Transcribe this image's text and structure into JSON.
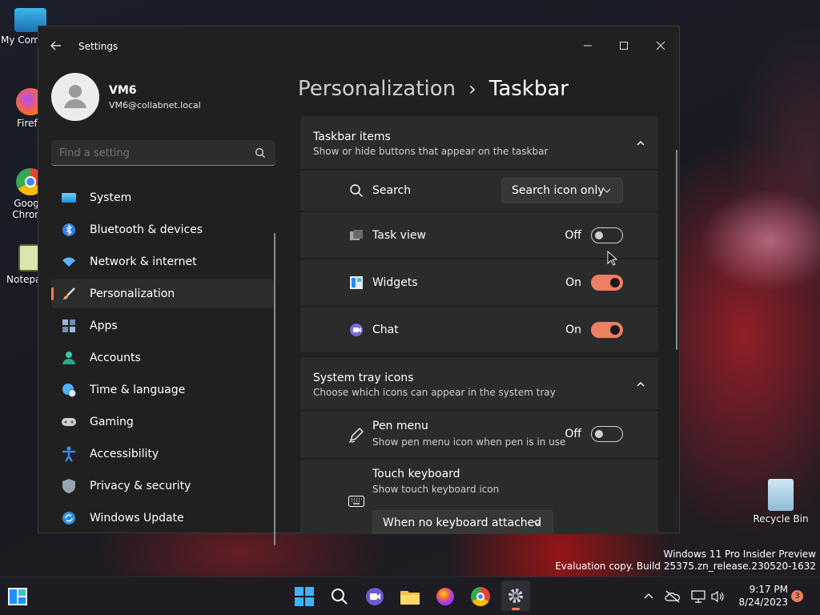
{
  "desktop": {
    "icons": [
      {
        "label": "My Com",
        "icon": "computer-icon"
      },
      {
        "label": "Firefo",
        "icon": "firefox-icon"
      },
      {
        "label": "Goog Chron",
        "icon": "chrome-icon"
      },
      {
        "label": "Notepa",
        "icon": "notepad-icon"
      },
      {
        "label": "Recycle Bin",
        "icon": "recycle-bin-icon"
      }
    ],
    "watermark_line1": "Windows 11 Pro Insider Preview",
    "watermark_line2": "Evaluation copy. Build 25375.zn_release.230520-1632"
  },
  "window": {
    "title": "Settings",
    "controls": [
      "minimize-icon",
      "maximize-icon",
      "close-icon"
    ]
  },
  "user": {
    "name": "VM6",
    "email": "VM6@collabnet.local"
  },
  "search": {
    "placeholder": "Find a setting"
  },
  "nav": [
    {
      "label": "System",
      "icon": "system-icon",
      "color": "#4cc2ff"
    },
    {
      "label": "Bluetooth & devices",
      "icon": "bluetooth-icon",
      "color": "#4c9bff"
    },
    {
      "label": "Network & internet",
      "icon": "wifi-icon",
      "color": "#5ab4ff"
    },
    {
      "label": "Personalization",
      "icon": "brush-icon",
      "color": "#f0a060",
      "selected": true
    },
    {
      "label": "Apps",
      "icon": "apps-icon",
      "color": "#9ab6d6"
    },
    {
      "label": "Accounts",
      "icon": "accounts-icon",
      "color": "#3fc4a8"
    },
    {
      "label": "Time & language",
      "icon": "globe-clock-icon",
      "color": "#4fb5ff"
    },
    {
      "label": "Gaming",
      "icon": "gamepad-icon",
      "color": "#cfcfcf"
    },
    {
      "label": "Accessibility",
      "icon": "accessibility-icon",
      "color": "#3a8fff"
    },
    {
      "label": "Privacy & security",
      "icon": "shield-icon",
      "color": "#9aa4b0"
    },
    {
      "label": "Windows Update",
      "icon": "update-icon",
      "color": "#2a8fe0"
    }
  ],
  "breadcrumb": {
    "parent": "Personalization",
    "separator": "›",
    "current": "Taskbar"
  },
  "taskbar_items": {
    "title": "Taskbar items",
    "subtitle": "Show or hide buttons that appear on the taskbar",
    "search": {
      "label": "Search",
      "value": "Search icon only"
    },
    "task_view": {
      "label": "Task view",
      "state": "Off",
      "on": false
    },
    "widgets": {
      "label": "Widgets",
      "state": "On",
      "on": true
    },
    "chat": {
      "label": "Chat",
      "state": "On",
      "on": true
    }
  },
  "system_tray": {
    "title": "System tray icons",
    "subtitle": "Choose which icons can appear in the system tray",
    "pen_menu": {
      "label": "Pen menu",
      "sub": "Show pen menu icon when pen is in use",
      "state": "Off",
      "on": false
    },
    "touch_keyboard": {
      "label": "Touch keyboard",
      "sub": "Show touch keyboard icon",
      "value": "When no keyboard attached"
    }
  },
  "taskbar": {
    "time": "9:17 PM",
    "date": "8/24/2023",
    "notification_count": "3",
    "accent": "#f07e62"
  }
}
